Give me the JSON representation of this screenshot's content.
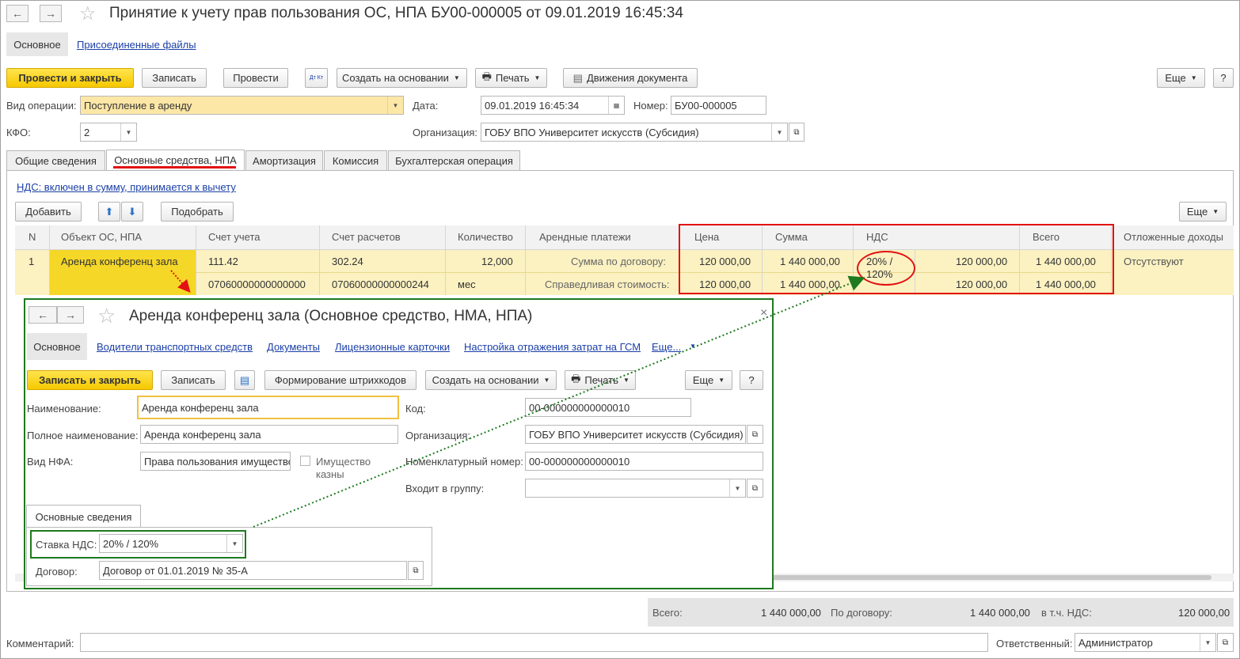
{
  "main": {
    "title": "Принятие к учету прав пользования ОС, НПА БУ00-000005 от 09.01.2019 16:45:34",
    "nav": {
      "back": "←",
      "forward": "→",
      "star": "☆"
    },
    "top_tabs": [
      "Основное",
      "Присоединенные файлы"
    ],
    "toolbar": {
      "post_close": "Провести и закрыть",
      "save": "Записать",
      "post": "Провести",
      "dtkt": "Дт Кт",
      "create_based": "Создать на основании",
      "print": "Печать",
      "movements": "Движения документа",
      "more": "Еще",
      "help": "?"
    },
    "fields": {
      "op_type_label": "Вид операции:",
      "op_type_value": "Поступление в аренду",
      "date_label": "Дата:",
      "date_value": "09.01.2019 16:45:34",
      "number_label": "Номер:",
      "number_value": "БУ00-000005",
      "kfo_label": "КФО:",
      "kfo_value": "2",
      "org_label": "Организация:",
      "org_value": "ГОБУ ВПО Университет искусств (Субсидия)"
    },
    "doc_tabs": [
      "Общие сведения",
      "Основные средства, НПА",
      "Амортизация",
      "Комиссия",
      "Бухгалтерская операция"
    ],
    "vat_link": "НДС: включен в сумму, принимается к вычету",
    "table_toolbar": {
      "add": "Добавить",
      "pick": "Подобрать",
      "more": "Еще"
    },
    "table": {
      "headers": [
        "N",
        "Объект ОС, НПА",
        "Счет учета",
        "Счет расчетов",
        "Количество",
        "Арендные платежи",
        "Цена",
        "Сумма",
        "НДС",
        "Всего",
        "Отложенные доходы"
      ],
      "row": {
        "n": "1",
        "object": "Аренда конференц зала",
        "account1": "111.42",
        "account2": "07060000000000000",
        "settle1": "302.24",
        "settle2": "07060000000000244",
        "qty": "12,000",
        "unit": "мес",
        "pay1": "Сумма по договору:",
        "pay2": "Справедливая стоимость:",
        "price1": "120 000,00",
        "price2": "120 000,00",
        "sum1": "1 440 000,00",
        "sum2": "1 440 000,00",
        "vat_rate_1": "20% /",
        "vat_rate_2": "120%",
        "vat1": "120 000,00",
        "vat2": "120 000,00",
        "total1": "1 440 000,00",
        "total2": "1 440 000,00",
        "deferred": "Отсутствуют"
      }
    },
    "totals": {
      "total_label": "Всего:",
      "total_value": "1 440 000,00",
      "contract_label": "По договору:",
      "contract_value": "1 440 000,00",
      "vat_label": "в т.ч. НДС:",
      "vat_value": "120 000,00"
    },
    "footer": {
      "comment_label": "Комментарий:",
      "responsible_label": "Ответственный:",
      "responsible_value": "Администратор"
    }
  },
  "modal": {
    "title": "Аренда конференц зала (Основное средство, НМА, НПА)",
    "close": "×",
    "tabs": [
      "Основное",
      "Водители транспортных средств",
      "Документы",
      "Лицензионные карточки",
      "Настройка отражения затрат на ГСМ",
      "Еще..."
    ],
    "toolbar": {
      "save_close": "Записать и закрыть",
      "save": "Записать",
      "barcodes": "Формирование штрихкодов",
      "create_based": "Создать на основании",
      "print": "Печать",
      "more": "Еще",
      "help": "?"
    },
    "fields": {
      "name_label": "Наименование:",
      "name_value": "Аренда конференц зала",
      "fullname_label": "Полное наименование:",
      "fullname_value": "Аренда конференц зала",
      "nfa_label": "Вид НФА:",
      "nfa_value": "Права пользования имущество",
      "treasury_label_1": "Имущество",
      "treasury_label_2": "казны",
      "code_label": "Код:",
      "code_value": "00-000000000000010",
      "org_label": "Организация:",
      "org_value": "ГОБУ ВПО Университет искусств (Субсидия)",
      "nomenclature_label": "Номенклатурный номер:",
      "nomenclature_value": "00-000000000000010",
      "group_label": "Входит в группу:",
      "group_value": ""
    },
    "inner_tab": "Основные сведения",
    "vat_label": "Ставка НДС:",
    "vat_value": "20% / 120%",
    "contract_label": "Договор:",
    "contract_value": "Договор от 01.01.2019 № 35-А"
  }
}
